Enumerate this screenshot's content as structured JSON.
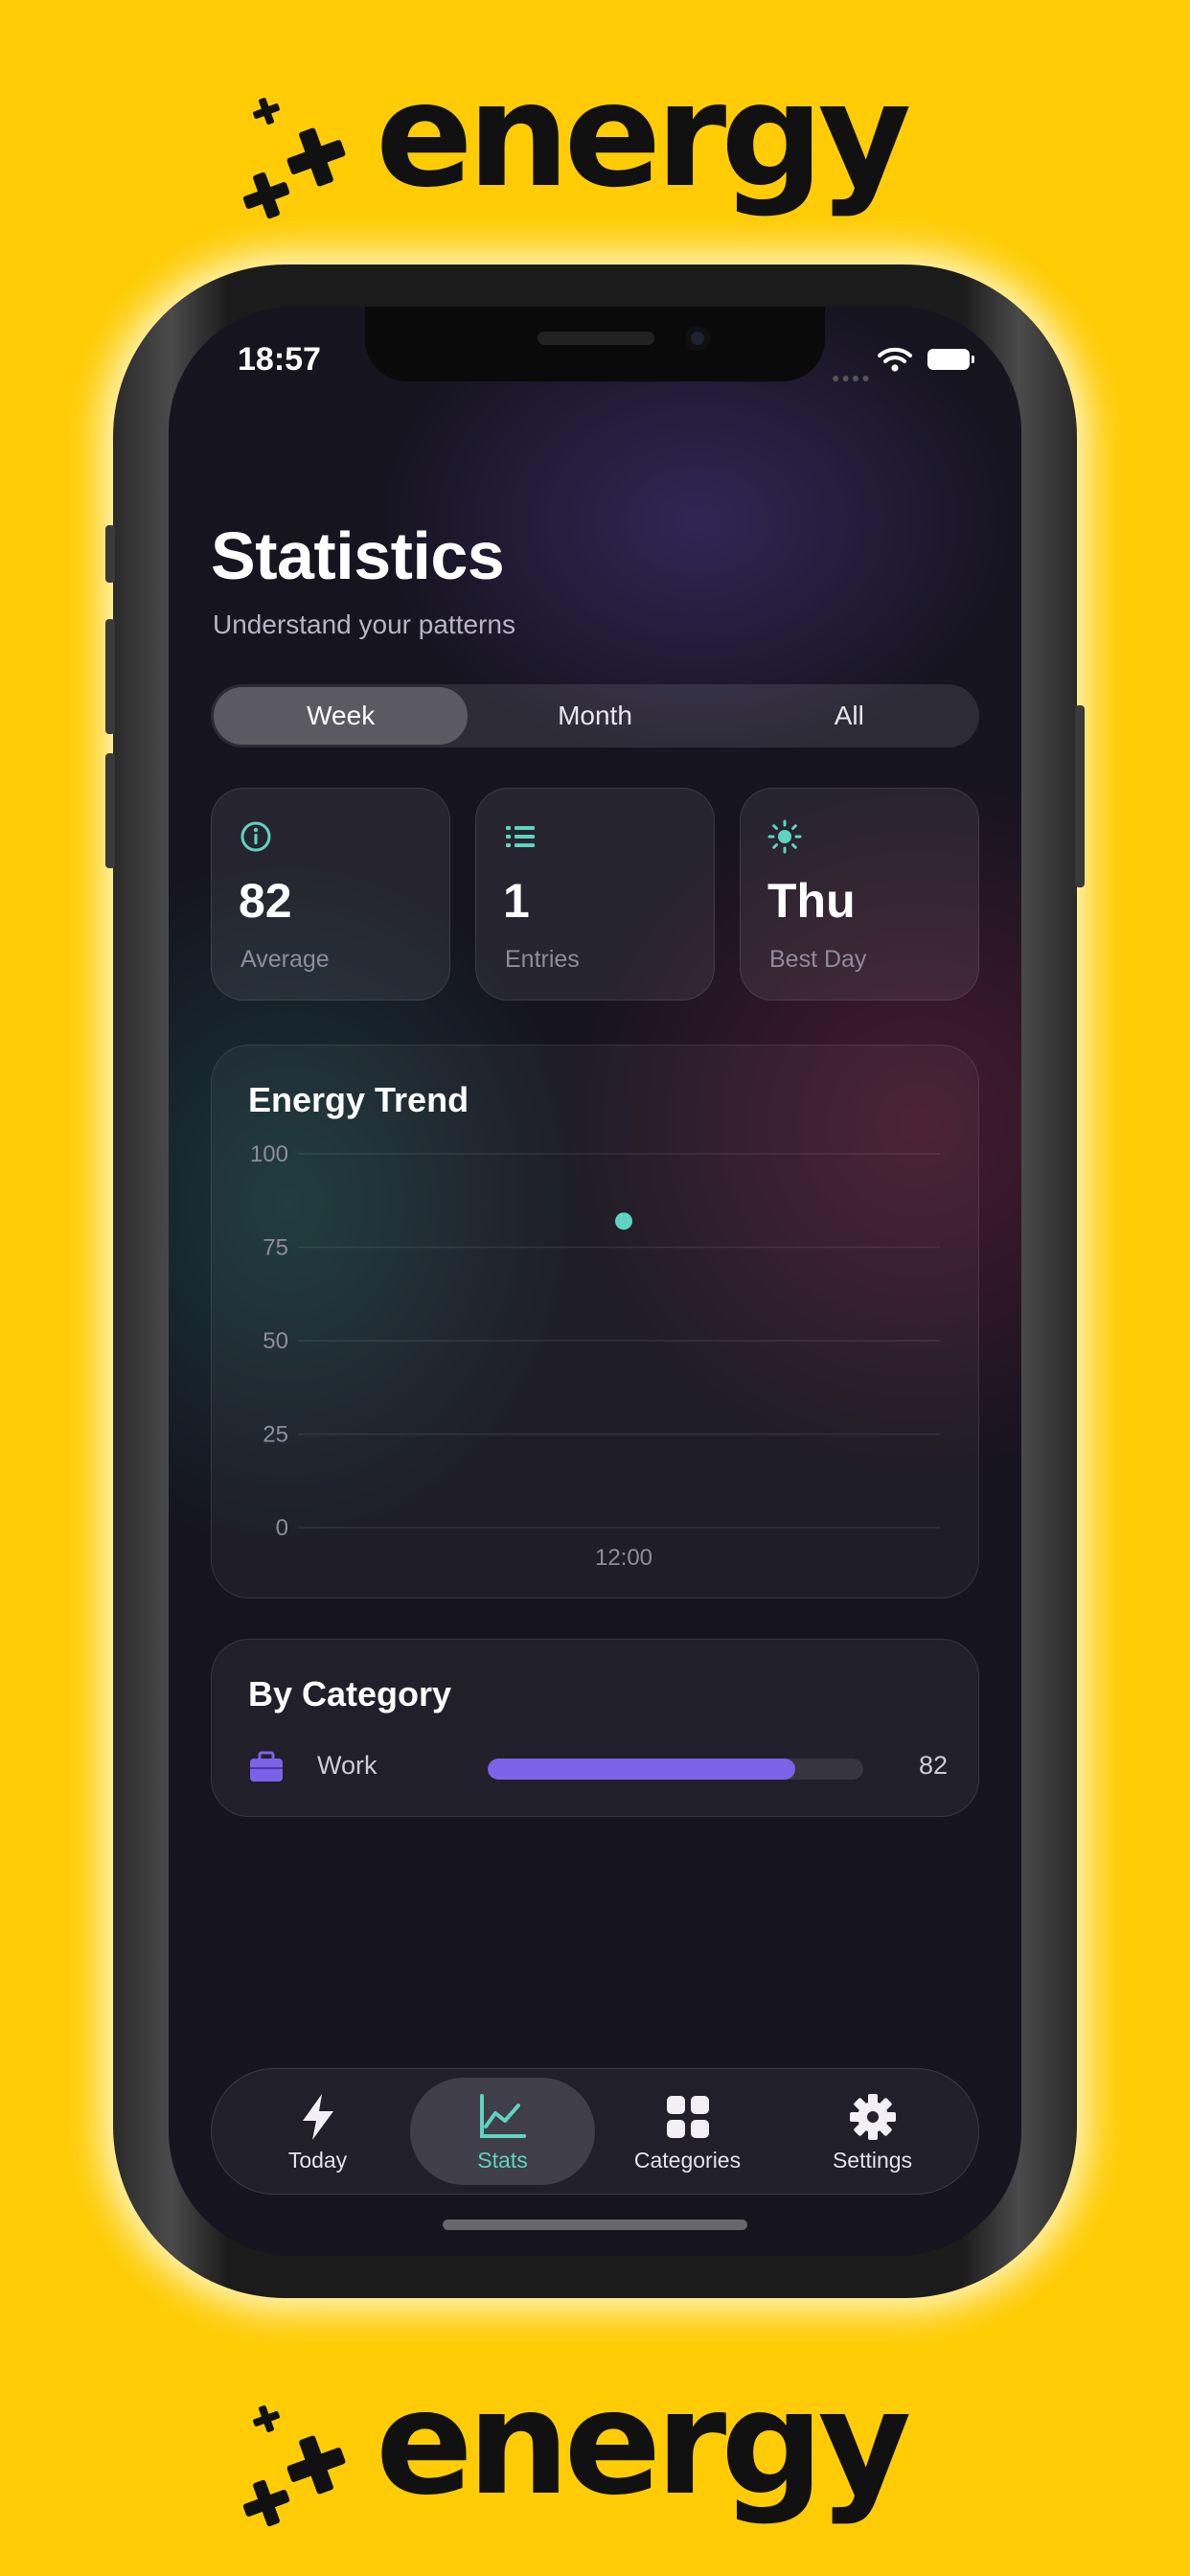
{
  "brand": {
    "name": "energy"
  },
  "status_bar": {
    "time": "18:57"
  },
  "header": {
    "title": "Statistics",
    "subtitle": "Understand your patterns"
  },
  "period_tabs": {
    "selected": "Week",
    "options": [
      "Week",
      "Month",
      "All"
    ]
  },
  "stats": [
    {
      "icon": "info-icon",
      "value": "82",
      "label": "Average"
    },
    {
      "icon": "list-icon",
      "value": "1",
      "label": "Entries"
    },
    {
      "icon": "sun-icon",
      "value": "Thu",
      "label": "Best Day"
    }
  ],
  "energy_trend": {
    "title": "Energy Trend",
    "chart_data": {
      "type": "scatter",
      "title": "Energy Trend",
      "y_ticks": [
        "100",
        "75",
        "50",
        "25",
        "0"
      ],
      "ylim": [
        0,
        100
      ],
      "x_ticks": [
        "12:00"
      ],
      "points": [
        {
          "x": "12:00",
          "y": 82
        }
      ],
      "grid": true,
      "point_color": "#5fd3c1"
    }
  },
  "by_category": {
    "title": "By Category",
    "items": [
      {
        "icon": "briefcase-icon",
        "name": "Work",
        "value": "82",
        "fraction": 0.82,
        "color": "#7b62e8"
      }
    ]
  },
  "tab_bar": {
    "selected": "Stats",
    "items": [
      {
        "icon": "bolt-icon",
        "label": "Today"
      },
      {
        "icon": "chart-icon",
        "label": "Stats"
      },
      {
        "icon": "grid-icon",
        "label": "Categories"
      },
      {
        "icon": "gear-icon",
        "label": "Settings"
      }
    ]
  },
  "colors": {
    "background": "#FFCC05",
    "accent": "#5fd3c1",
    "category_bar": "#7b62e8"
  }
}
